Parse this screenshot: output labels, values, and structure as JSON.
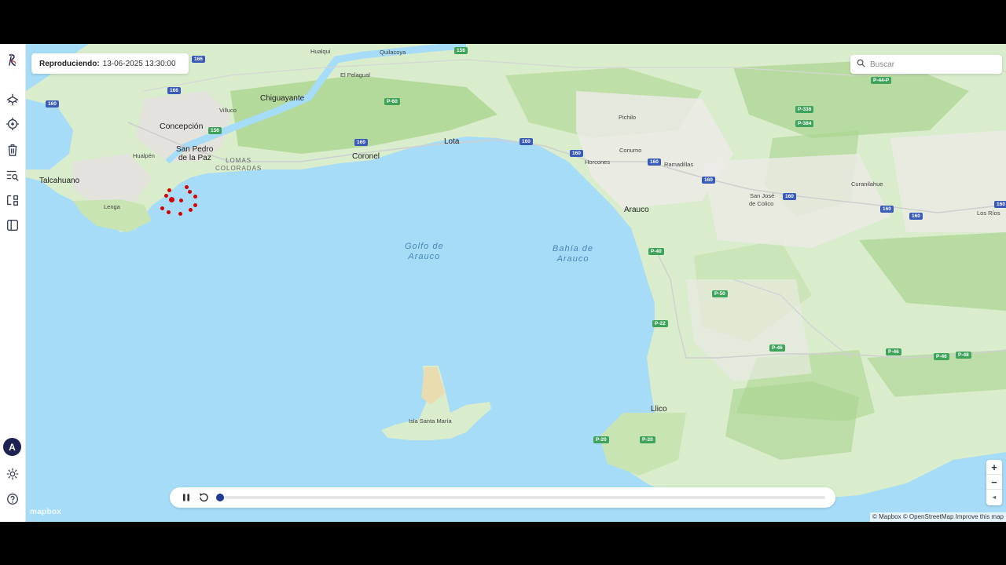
{
  "playback": {
    "label": "Reproduciendo:",
    "datetime": "13-06-2025 13:30:00",
    "progress": 0
  },
  "search": {
    "placeholder": "Buscar"
  },
  "sidebar": {
    "items": [
      {
        "icon": "logo-icon"
      },
      {
        "icon": "drone-icon"
      },
      {
        "icon": "target-icon"
      },
      {
        "icon": "trash-icon"
      },
      {
        "icon": "list-search-icon"
      },
      {
        "icon": "route-icon"
      },
      {
        "icon": "panel-toggle-icon"
      }
    ],
    "avatar_letter": "A",
    "settings_icon": "gear-icon",
    "help_icon": "help-icon"
  },
  "zoom": {
    "in": "+",
    "out": "−",
    "compass": "◂"
  },
  "attribution": {
    "text": "© Mapbox © OpenStreetMap  Improve this map",
    "logo": "mapbox"
  },
  "map": {
    "places": [
      "Hualqui",
      "Quilacoya",
      "El Pelagual",
      "Chiguayante",
      "Villuco",
      "Concepción",
      "San Pedro",
      "de la Paz",
      "Hualpén",
      "Talcahuano",
      "Lenga",
      "Coronel",
      "Lota",
      "Pichilo",
      "Conumo",
      "Horcones",
      "Ramadillas",
      "San José",
      "de Colico",
      "Curanilahue",
      "Los Ríos",
      "Arauco",
      "Llico",
      "Isla Santa María"
    ],
    "areas": [
      "LOMAS",
      "COLORADAS"
    ],
    "waters": [
      [
        "Golfo de",
        "Arauco"
      ],
      [
        "Bahía de",
        "Arauco"
      ]
    ],
    "shields": [
      "166",
      "156",
      "160",
      "P-60",
      "P-336",
      "P-384",
      "P-40",
      "P-22",
      "P-20",
      "P-50",
      "P-46",
      "P-48",
      "P-44-P"
    ],
    "marker_color": "#d40000"
  }
}
